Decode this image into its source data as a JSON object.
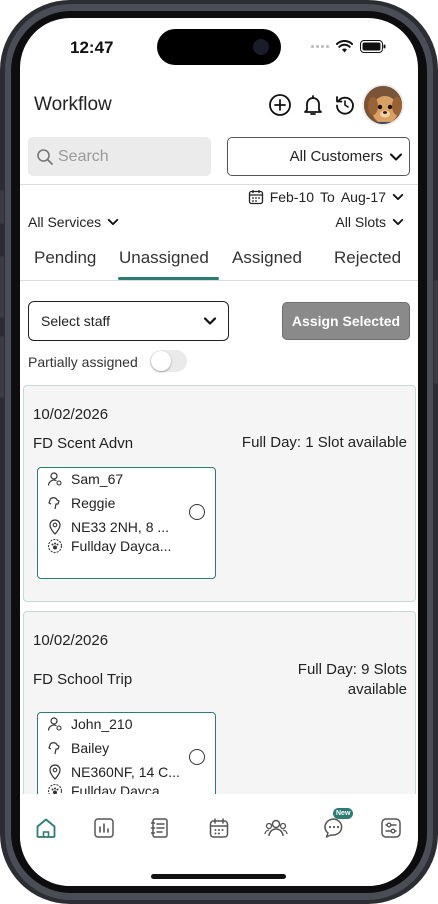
{
  "status_bar": {
    "time": "12:47"
  },
  "header": {
    "title": "Workflow",
    "icons": [
      "add-circle-icon",
      "bell-icon",
      "refresh-icon"
    ]
  },
  "search": {
    "placeholder": "Search"
  },
  "customers": {
    "selected": "All Customers"
  },
  "date_range": {
    "from": "Feb-10",
    "to_label": "To",
    "to": "Aug-17"
  },
  "filters": {
    "services": "All Services",
    "slots": "All Slots"
  },
  "tabs": [
    {
      "label": "Pending",
      "active": false
    },
    {
      "label": "Unassigned",
      "active": true
    },
    {
      "label": "Assigned",
      "active": false
    },
    {
      "label": "Rejected",
      "active": false
    }
  ],
  "staff": {
    "placeholder": "Select staff",
    "assign_label": "Assign Selected"
  },
  "partial": {
    "label": "Partially assigned",
    "on": false
  },
  "cards": [
    {
      "date": "10/02/2026",
      "name": "FD Scent Advn",
      "slots": "Full Day: 1 Slot available",
      "entry": {
        "user": "Sam_67",
        "pet": "Reggie",
        "address": "NE33 2NH, 8 ...",
        "service": "Fullday Dayca..."
      }
    },
    {
      "date": "10/02/2026",
      "name": "FD School Trip",
      "slots_line1": "Full Day: 9 Slots",
      "slots_line2": "available",
      "entry": {
        "user": "John_210",
        "pet": "Bailey",
        "address": "NE360NF, 14 C...",
        "service": "Fullday Dayca..."
      }
    }
  ],
  "bottom_nav": {
    "items": [
      "home-icon",
      "reports-icon",
      "notes-icon",
      "calendar-icon",
      "people-icon",
      "chat-icon",
      "settings-icon"
    ],
    "badge": "New"
  },
  "colors": {
    "accent": "#2c7b74",
    "button_disabled": "#8a8a8a",
    "card_bg": "#f5f5f5"
  }
}
